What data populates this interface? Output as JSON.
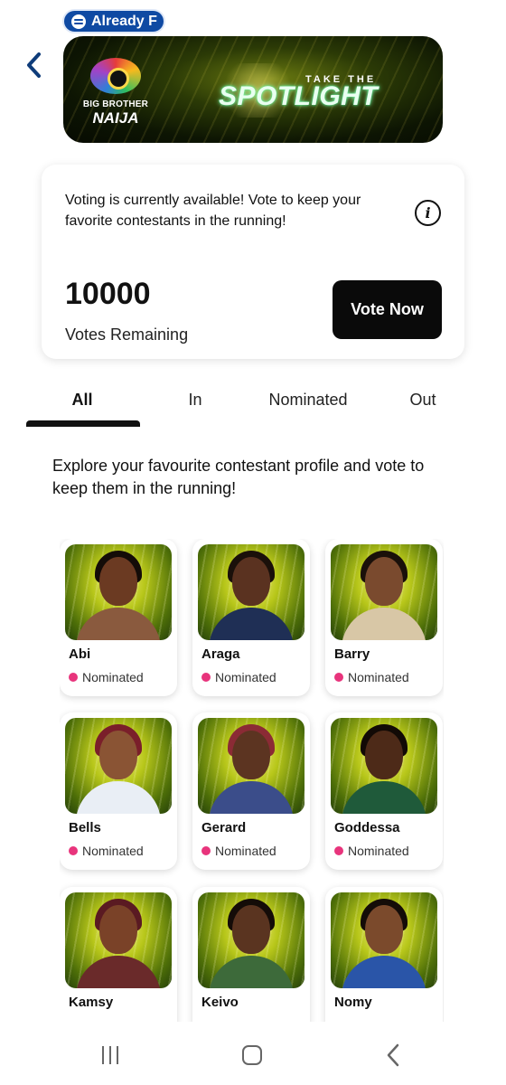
{
  "status_pill": {
    "label": "Already F",
    "icon": "spotify-icon"
  },
  "header": {
    "back_icon": "chevron-left-icon"
  },
  "banner": {
    "logo_line1": "BIG BROTHER",
    "logo_line2": "NAIJA",
    "tagline_small": "TAKE THE",
    "tagline_big": "SPOTLIGHT"
  },
  "vote_card": {
    "message": "Voting is currently available! Vote to keep your favorite contestants in the running!",
    "info_icon": "info-icon",
    "info_symbol": "i",
    "votes_remaining": "10000",
    "votes_label": "Votes Remaining",
    "vote_button": "Vote Now"
  },
  "tabs": [
    {
      "label": "All",
      "active": true
    },
    {
      "label": "In",
      "active": false
    },
    {
      "label": "Nominated",
      "active": false
    },
    {
      "label": "Out",
      "active": false
    }
  ],
  "explore_text": "Explore your favourite contestant profile and vote to keep them in the running!",
  "status_color": "#e8347c",
  "contestants": [
    {
      "name": "Abi",
      "status": "Nominated",
      "skin": "#6b3a22",
      "hair": "#140c08",
      "outfit": "#8a5a3e"
    },
    {
      "name": "Araga",
      "status": "Nominated",
      "skin": "#5a3220",
      "hair": "#1a100a",
      "outfit": "#1f2f55"
    },
    {
      "name": "Barry",
      "status": "Nominated",
      "skin": "#7a4a2e",
      "hair": "#1a100a",
      "outfit": "#d8c7a6"
    },
    {
      "name": "Bells",
      "status": "Nominated",
      "skin": "#8a5434",
      "hair": "#7a1f2a",
      "outfit": "#e9eef5"
    },
    {
      "name": "Gerard",
      "status": "Nominated",
      "skin": "#5c3421",
      "hair": "#8b2b35",
      "outfit": "#3b4d8a"
    },
    {
      "name": "Goddessa",
      "status": "Nominated",
      "skin": "#4d2a18",
      "hair": "#120a06",
      "outfit": "#1f5a3a"
    },
    {
      "name": "Kamsy",
      "status": "",
      "skin": "#7a4228",
      "hair": "#5a1a22",
      "outfit": "#6a2a2a"
    },
    {
      "name": "Keivo",
      "status": "",
      "skin": "#5a3420",
      "hair": "#140c08",
      "outfit": "#3d6a3a"
    },
    {
      "name": "Nomy",
      "status": "",
      "skin": "#7b4a2c",
      "hair": "#140c08",
      "outfit": "#2a55a8"
    }
  ],
  "navbar": {
    "recents_icon": "recents-icon",
    "home_icon": "home-icon",
    "back_icon": "back-icon"
  }
}
